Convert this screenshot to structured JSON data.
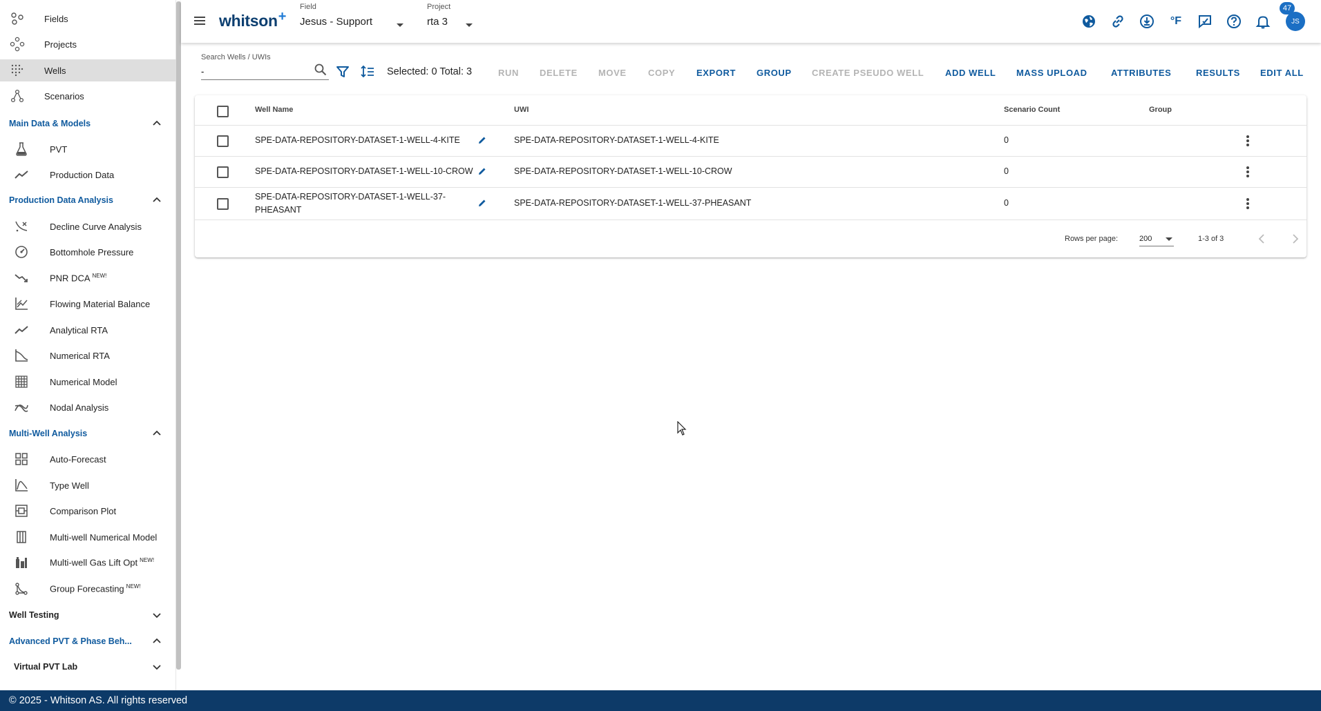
{
  "sidebar": {
    "top_items": [
      {
        "label": "Fields",
        "icon": "fields-icon"
      },
      {
        "label": "Projects",
        "icon": "projects-icon"
      },
      {
        "label": "Wells",
        "icon": "wells-icon"
      },
      {
        "label": "Scenarios",
        "icon": "scenarios-icon"
      }
    ],
    "sections": [
      {
        "title": "Main Data & Models",
        "items": [
          {
            "label": "PVT",
            "icon": "flask-icon"
          },
          {
            "label": "Production Data",
            "icon": "trend-icon"
          }
        ]
      },
      {
        "title": "Production Data Analysis",
        "items": [
          {
            "label": "Decline Curve Analysis",
            "icon": "decline-icon"
          },
          {
            "label": "Bottomhole Pressure",
            "icon": "gauge-icon"
          },
          {
            "label": "PNR DCA",
            "icon": "pnr-icon",
            "badge": "NEW!"
          },
          {
            "label": "Flowing Material Balance",
            "icon": "fmb-chart-icon"
          },
          {
            "label": "Analytical RTA",
            "icon": "analytical-rta-icon"
          },
          {
            "label": "Numerical RTA",
            "icon": "numerical-rta-icon"
          },
          {
            "label": "Numerical Model",
            "icon": "grid-model-icon"
          },
          {
            "label": "Nodal Analysis",
            "icon": "nodal-icon"
          }
        ]
      },
      {
        "title": "Multi-Well Analysis",
        "items": [
          {
            "label": "Auto-Forecast",
            "icon": "auto-forecast-icon"
          },
          {
            "label": "Type Well",
            "icon": "type-well-icon"
          },
          {
            "label": "Comparison Plot",
            "icon": "comparison-icon"
          },
          {
            "label": "Multi-well Numerical Model",
            "icon": "multiwell-model-icon"
          },
          {
            "label": "Multi-well Gas Lift Opt",
            "icon": "gas-lift-icon",
            "badge": "NEW!"
          },
          {
            "label": "Group Forecasting",
            "icon": "group-forecast-icon",
            "badge": "NEW!"
          }
        ]
      }
    ],
    "collapsed": [
      {
        "title": "Well Testing"
      },
      {
        "title": "Advanced PVT & Phase Beh..."
      },
      {
        "title": "Virtual PVT Lab"
      }
    ]
  },
  "topbar": {
    "logo": "whitson",
    "logo_plus": "+",
    "field_caption": "Field",
    "field_value": "Jesus - Support",
    "project_caption": "Project",
    "project_value": "rta 3",
    "notification_count": "47",
    "avatar_initials": "JS",
    "icons": [
      "globe-icon",
      "link-icon",
      "download-icon",
      "fahrenheit-icon",
      "feedback-icon",
      "help-icon",
      "bell-icon"
    ],
    "fahrenheit_text": "°F"
  },
  "toolbar": {
    "search_caption": "Search Wells / UWIs",
    "search_value": "-",
    "selected_total": "Selected: 0 Total: 3",
    "buttons": [
      {
        "label": "RUN",
        "enabled": false
      },
      {
        "label": "DELETE",
        "enabled": false
      },
      {
        "label": "MOVE",
        "enabled": false
      },
      {
        "label": "COPY",
        "enabled": false
      },
      {
        "label": "EXPORT",
        "enabled": true
      },
      {
        "label": "GROUP",
        "enabled": true
      },
      {
        "label": "CREATE PSEUDO WELL",
        "enabled": false
      },
      {
        "label": "ADD WELL",
        "enabled": true
      },
      {
        "label": "MASS UPLOAD",
        "enabled": true
      },
      {
        "label": "ATTRIBUTES",
        "enabled": true
      },
      {
        "label": "RESULTS",
        "enabled": true
      },
      {
        "label": "EDIT ALL",
        "enabled": true
      }
    ]
  },
  "table": {
    "columns": [
      "Well Name",
      "UWI",
      "Scenario Count",
      "Group"
    ],
    "rows": [
      {
        "name": "SPE-DATA-REPOSITORY-DATASET-1-WELL-4-KITE",
        "name2": "",
        "uwi": "SPE-DATA-REPOSITORY-DATASET-1-WELL-4-KITE",
        "scenario_count": "0",
        "group": ""
      },
      {
        "name": "SPE-DATA-REPOSITORY-DATASET-1-WELL-10-CROW",
        "name2": "",
        "uwi": "SPE-DATA-REPOSITORY-DATASET-1-WELL-10-CROW",
        "scenario_count": "0",
        "group": ""
      },
      {
        "name": "SPE-DATA-REPOSITORY-DATASET-1-WELL-37-",
        "name2": "PHEASANT",
        "uwi": "SPE-DATA-REPOSITORY-DATASET-1-WELL-37-PHEASANT",
        "scenario_count": "0",
        "group": ""
      }
    ],
    "rows_per_page_label": "Rows per page:",
    "rows_per_page": "200",
    "range": "1-3 of 3"
  },
  "footer": {
    "copyright": "© 2025 - Whitson AS. All rights reserved"
  },
  "colors": {
    "accent": "#0f5a9e",
    "footer_bg": "#0d3a68",
    "badge": "#1b6fc4",
    "disabled": "#b4b4b4"
  }
}
